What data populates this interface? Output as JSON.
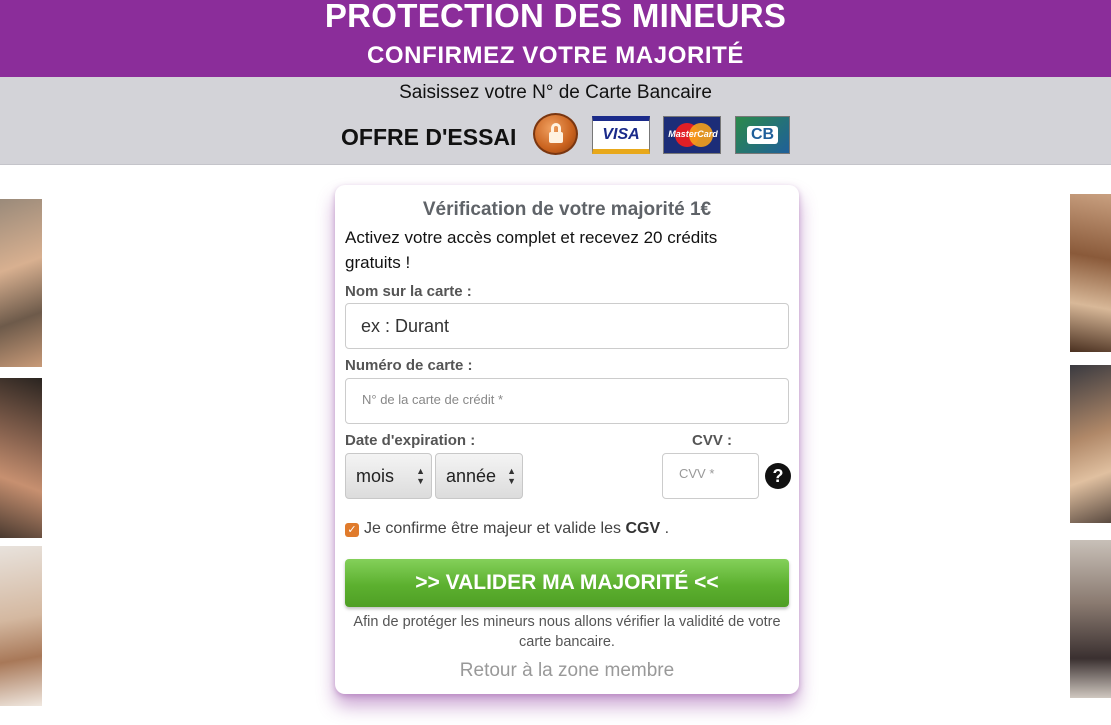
{
  "header": {
    "title": "PROTECTION DES MINEURS",
    "subtitle": "CONFIRMEZ VOTRE MAJORITÉ"
  },
  "subbar": {
    "instruction": "Saisissez votre N° de Carte Bancaire",
    "trial": "OFFRE D'ESSAI",
    "logos": {
      "visa": "VISA",
      "mastercard": "MasterCard",
      "cb": "CB"
    }
  },
  "form": {
    "title": "Vérification de votre majorité 1€",
    "promo": "Activez votre accès complet et recevez 20 crédits gratuits !",
    "name_label": "Nom sur la carte :",
    "name_placeholder": "ex : Durant",
    "number_label": "Numéro de carte :",
    "number_placeholder": "N° de la carte de crédit *",
    "expiry_label": "Date d'expiration :",
    "month_value": "mois",
    "year_value": "année",
    "cvv_label": "CVV :",
    "cvv_placeholder": "CVV *",
    "help_symbol": "?",
    "confirm_text": "Je confirme être majeur et valide les",
    "confirm_link": "CGV",
    "confirm_end": ".",
    "submit_label": ">> VALIDER MA MAJORITÉ <<",
    "note": "Afin de protéger les mineurs nous allons vérifier la validité de votre carte bancaire.",
    "back_link": "Retour à la zone membre"
  },
  "colors": {
    "header_bg": "#8b2d9a",
    "button_green": "#5cb02f",
    "checkbox": "#e07b2c"
  }
}
